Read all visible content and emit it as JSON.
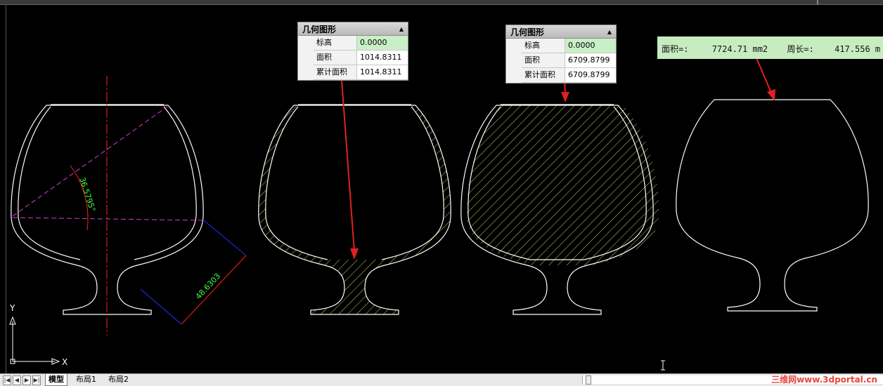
{
  "panels": [
    {
      "title": "几何图形",
      "rows": [
        {
          "key": "标高",
          "value": "0.0000"
        },
        {
          "key": "面积",
          "value": "1014.8311"
        },
        {
          "key": "累计面积",
          "value": "1014.8311"
        }
      ]
    },
    {
      "title": "几何图形",
      "rows": [
        {
          "key": "标高",
          "value": "0.0000"
        },
        {
          "key": "面积",
          "value": "6709.8799"
        },
        {
          "key": "累计面积",
          "value": "6709.8799"
        }
      ]
    }
  ],
  "status": {
    "area_label": "面积=:",
    "area_value": "7724.71 mm2",
    "perimeter_label": "周长=:",
    "perimeter_value": "417.556 m"
  },
  "dimensions": {
    "angle": "36.5795°",
    "length": "48.6303"
  },
  "axes": {
    "x": "X",
    "y": "Y"
  },
  "tabs": [
    "模型",
    "布局1",
    "布局2"
  ],
  "watermark": "三维网www.3dportal.cn",
  "colors": {
    "background": "#000000",
    "outline": "#ffffff",
    "centerline": "#ff2020",
    "construction": "#d040d0",
    "dimension_text": "#40ff40",
    "dimension_line": "#2020ff",
    "hatch": "#e8e870",
    "leader": "#e02020"
  }
}
